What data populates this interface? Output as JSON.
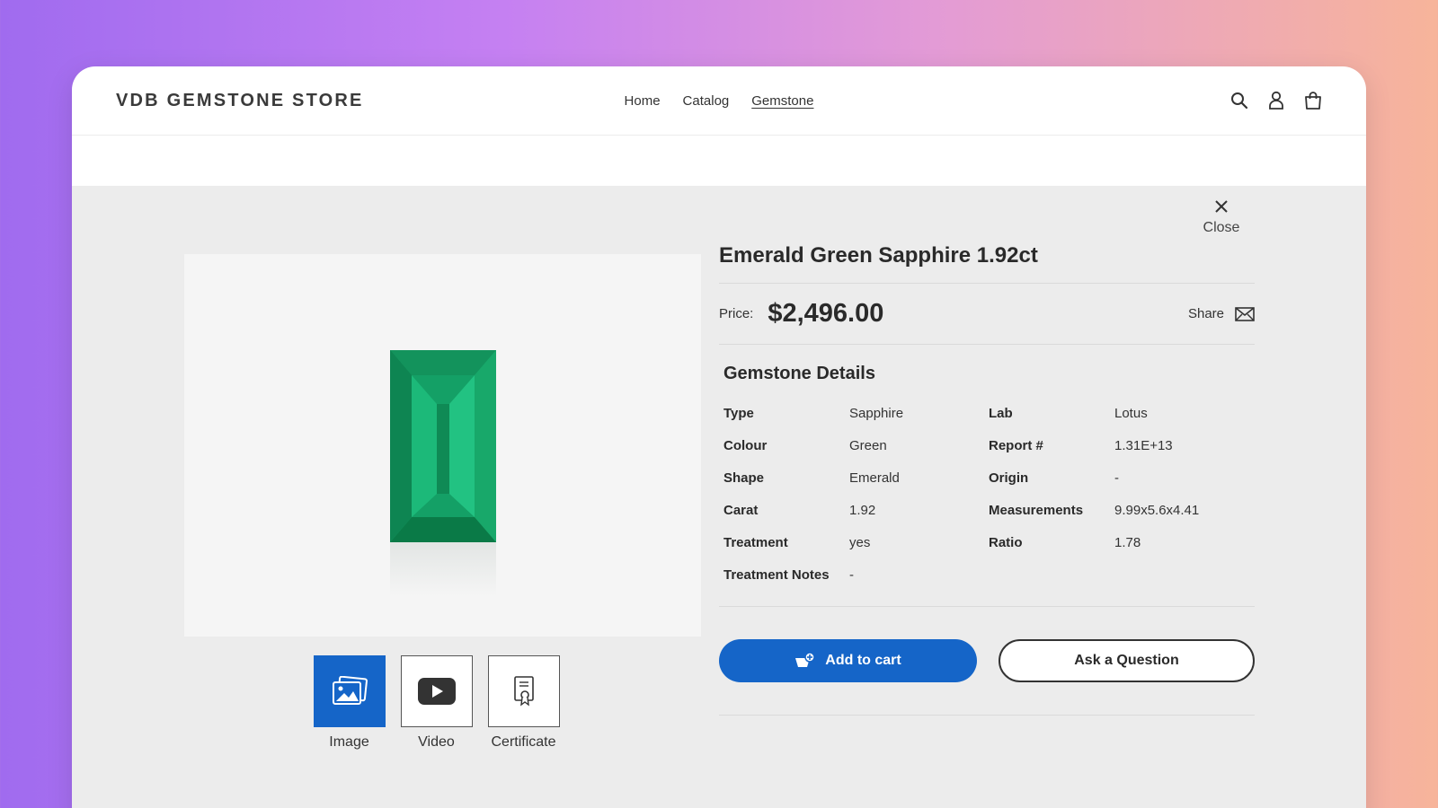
{
  "header": {
    "logo": "VDB GEMSTONE STORE",
    "nav": [
      {
        "label": "Home",
        "active": false
      },
      {
        "label": "Catalog",
        "active": false
      },
      {
        "label": "Gemstone",
        "active": true
      }
    ],
    "icons": [
      "search-icon",
      "account-icon",
      "cart-icon"
    ]
  },
  "modal": {
    "close_label": "Close",
    "title": "Emerald Green Sapphire 1.92ct",
    "price_label": "Price:",
    "price": "$2,496.00",
    "share_label": "Share",
    "details_title": "Gemstone Details",
    "specs": [
      {
        "key": "Type",
        "value": "Sapphire"
      },
      {
        "key": "Lab",
        "value": "Lotus"
      },
      {
        "key": "Colour",
        "value": "Green"
      },
      {
        "key": "Report #",
        "value": "1.31E+13"
      },
      {
        "key": "Shape",
        "value": "Emerald"
      },
      {
        "key": "Origin",
        "value": "-"
      },
      {
        "key": "Carat",
        "value": "1.92"
      },
      {
        "key": "Measurements",
        "value": "9.99x5.6x4.41"
      },
      {
        "key": "Treatment",
        "value": "yes"
      },
      {
        "key": "Ratio",
        "value": "1.78"
      },
      {
        "key": "Treatment Notes",
        "value": "-"
      }
    ],
    "add_to_cart": "Add to cart",
    "ask_question": "Ask a Question",
    "media_tabs": [
      {
        "label": "Image",
        "icon": "image-icon",
        "active": true
      },
      {
        "label": "Video",
        "icon": "video-play-icon",
        "active": false
      },
      {
        "label": "Certificate",
        "icon": "certificate-icon",
        "active": false
      }
    ]
  },
  "colors": {
    "accent": "#1565c8",
    "modal_bg": "#ececec",
    "gem": "#0f9e63"
  }
}
